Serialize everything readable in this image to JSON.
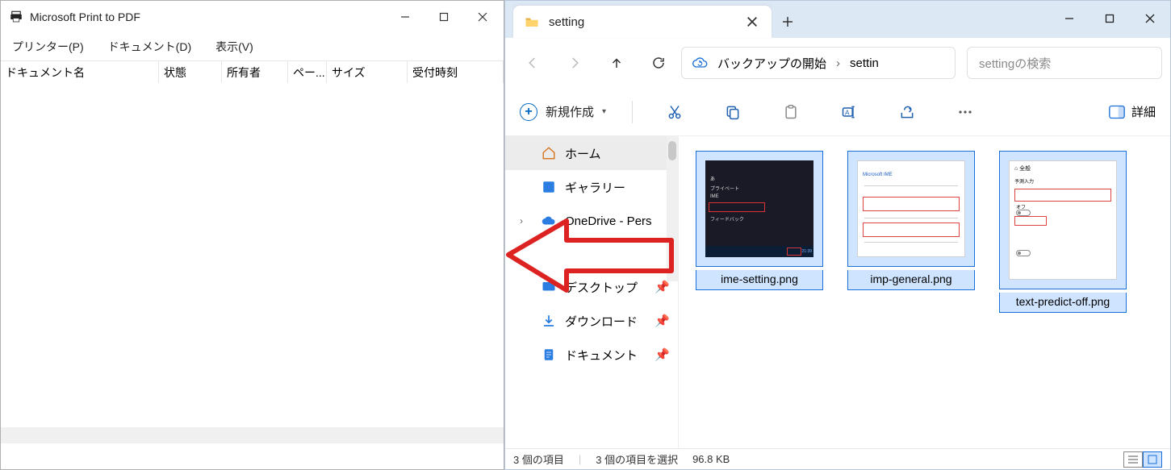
{
  "print_window": {
    "title": "Microsoft Print to PDF",
    "menus": {
      "printer": "プリンター(P)",
      "document": "ドキュメント(D)",
      "view": "表示(V)"
    },
    "columns": {
      "document_name": "ドキュメント名",
      "status": "状態",
      "owner": "所有者",
      "pages": "ペー...",
      "size": "サイズ",
      "submitted": "受付時刻"
    }
  },
  "explorer": {
    "tab_title": "setting",
    "address": {
      "backup_label": "バックアップの開始",
      "folder": "settin"
    },
    "search_placeholder": "settingの検索",
    "toolbar": {
      "new_label": "新規作成",
      "details_label": "詳細"
    },
    "nav": {
      "home": "ホーム",
      "gallery": "ギャラリー",
      "onedrive": "OneDrive - Pers",
      "desktop": "デスクトップ",
      "downloads": "ダウンロード",
      "documents": "ドキュメント"
    },
    "files": [
      {
        "name": "ime-setting.png"
      },
      {
        "name": "imp-general.png"
      },
      {
        "name": "text-predict-off.png"
      }
    ],
    "status": {
      "count": "3 個の項目",
      "selected": "3 個の項目を選択",
      "size": "96.8 KB"
    }
  }
}
